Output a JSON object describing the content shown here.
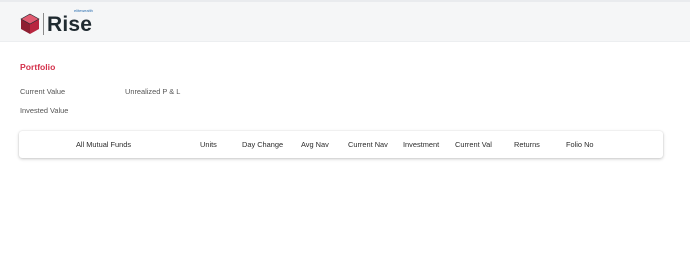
{
  "header": {
    "brand_sub": "elitewealth",
    "brand_name": "Rise"
  },
  "portfolio": {
    "title": "Portfolio",
    "current_value_label": "Current Value",
    "unrealized_pl_label": "Unrealized P & L",
    "invested_value_label": "Invested Value"
  },
  "table": {
    "columns": [
      "All Mutual Funds",
      "Units",
      "Day Change",
      "Avg Nav",
      "Current Nav",
      "Investment",
      "Current Val",
      "Returns",
      "Folio No"
    ]
  },
  "colors": {
    "accent": "#d4314b",
    "header_bg": "#f5f6f7",
    "logo_text": "#1f2a30"
  }
}
